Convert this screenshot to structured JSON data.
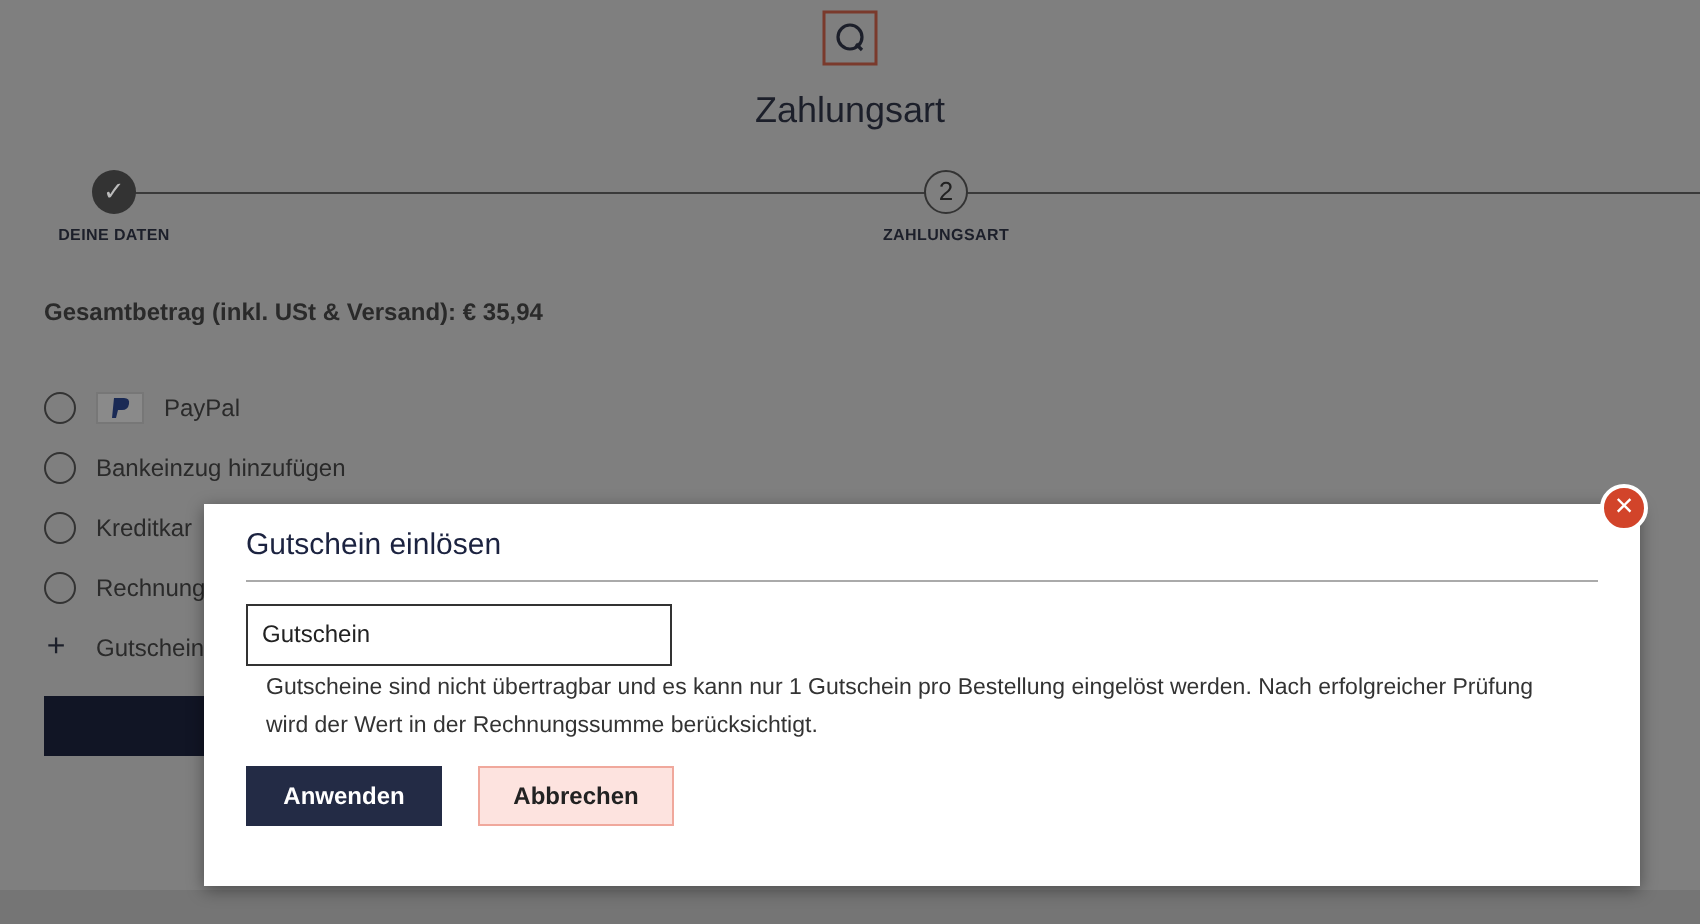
{
  "header": {
    "title": "Zahlungsart"
  },
  "steps": [
    {
      "label": "DEINE DATEN",
      "number": "✓",
      "done": true
    },
    {
      "label": "ZAHLUNGSART",
      "number": "2",
      "done": false
    }
  ],
  "total": "Gesamtbetrag (inkl. USt & Versand): € 35,94",
  "payment_options": [
    {
      "kind": "radio",
      "label": "PayPal",
      "logo": true,
      "selected": false
    },
    {
      "kind": "radio",
      "label": "Bankeinzug hinzufügen",
      "selected": false
    },
    {
      "kind": "radio",
      "label": "Kreditkar",
      "selected": false
    },
    {
      "kind": "radio",
      "label": "Rechnung",
      "selected": false
    },
    {
      "kind": "add",
      "icon": "+",
      "label": "Gutschein"
    }
  ],
  "dialog": {
    "title": "Gutschein einlösen",
    "close": "×",
    "field": {
      "placeholder": "Gutschein"
    },
    "note": "Gutscheine sind nicht übertragbar und es kann nur 1 Gutschein pro Bestellung eingelöst werden. Nach erfolgreicher Prüfung wird der Wert in der Rechnungssumme berücksichtigt.",
    "buttons": [
      {
        "kind": "primary",
        "label": "Anwenden"
      },
      {
        "kind": "secondary",
        "label": "Abbrechen"
      }
    ]
  }
}
